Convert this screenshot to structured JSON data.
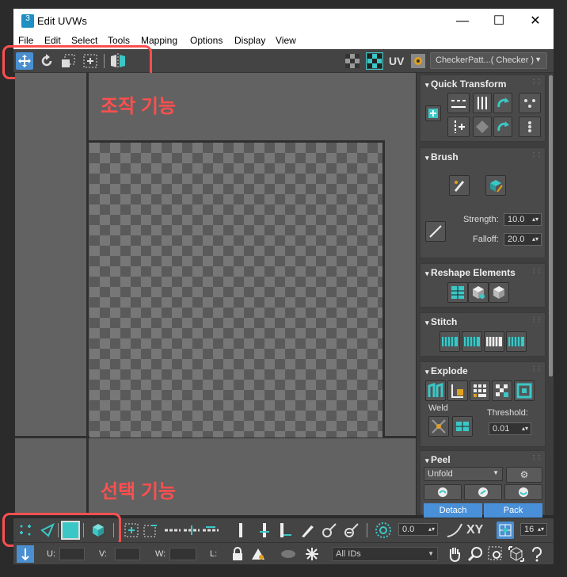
{
  "window": {
    "title": "Edit UVWs",
    "app_icon_text": "3",
    "minimize": "—",
    "maximize": "☐",
    "close": "✕"
  },
  "menu": [
    "File",
    "Edit",
    "Select",
    "Tools",
    "Mapping",
    "Options",
    "Display",
    "View"
  ],
  "toolbar": {
    "uv_label": "UV",
    "texture_dropdown": "CheckerPatt...( Checker )"
  },
  "annotations": {
    "top": "조작 기능",
    "bottom": "선택 기능"
  },
  "panels": {
    "quick_transform": {
      "title": "Quick Transform"
    },
    "brush": {
      "title": "Brush",
      "strength_label": "Strength:",
      "strength": "10.0",
      "falloff_label": "Falloff:",
      "falloff": "20.0"
    },
    "reshape": {
      "title": "Reshape Elements"
    },
    "stitch": {
      "title": "Stitch"
    },
    "explode": {
      "title": "Explode",
      "weld_label": "Weld",
      "threshold_label": "Threshold:",
      "threshold": "0.01"
    },
    "peel": {
      "title": "Peel",
      "unfold": "Unfold",
      "detach": "Detach",
      "pack": "Pack"
    }
  },
  "bottom": {
    "angle_value": "0.0",
    "xy_label": "XY",
    "grid_value": "16"
  },
  "status": {
    "u_label": "U:",
    "v_label": "V:",
    "w_label": "W:",
    "l_label": "L:",
    "ids_dropdown": "All IDs"
  },
  "colors": {
    "accent": "#1f8fc4",
    "highlight": "#ff4f4f",
    "teal": "#3cc7c7",
    "orange": "#e0a020"
  }
}
